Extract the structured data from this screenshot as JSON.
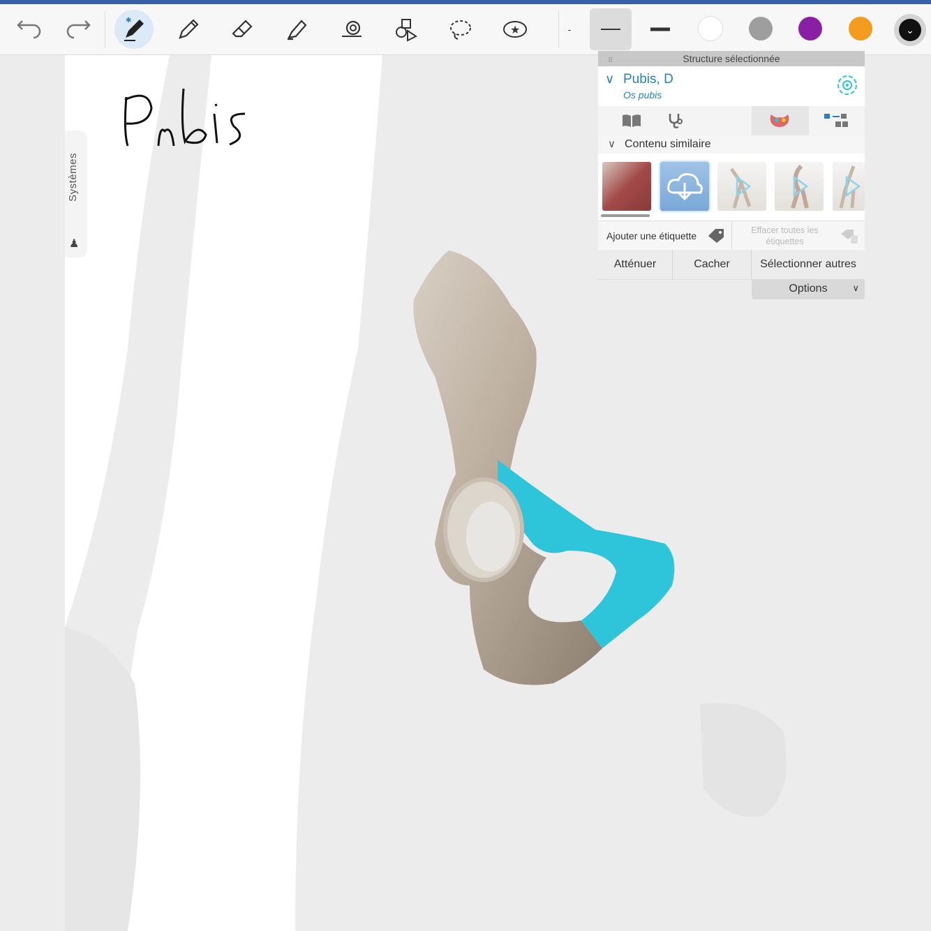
{
  "toolbar": {
    "tools": [
      {
        "name": "undo-icon"
      },
      {
        "name": "redo-icon"
      },
      {
        "name": "pen-icon",
        "active": true
      },
      {
        "name": "pencil-icon"
      },
      {
        "name": "eraser-icon"
      },
      {
        "name": "highlighter-icon"
      },
      {
        "name": "shape-icon"
      },
      {
        "name": "lasso-icon"
      },
      {
        "name": "sticker-icon"
      }
    ],
    "thickness_label": "-",
    "colors": [
      "#ffffff",
      "#9e9e9e",
      "#8b1fa3",
      "#f39c20",
      "#111111"
    ]
  },
  "canvas": {
    "handwritten_text": "Pubis"
  },
  "systems_tab": {
    "label": "Systèmes"
  },
  "panel": {
    "header": "Structure sélectionnée",
    "structure_name": "Pubis, D",
    "structure_latin": "Os pubis",
    "similar_content_label": "Contenu similaire",
    "add_label": "Ajouter une étiquette",
    "clear_labels": "Effacer toutes les étiquettes",
    "actions": {
      "dim": "Atténuer",
      "hide": "Cacher",
      "select_others": "Sélectionner autres"
    },
    "options_label": "Options",
    "accent_color": "#2a7fbf",
    "highlight_color": "#2ec4d9"
  }
}
